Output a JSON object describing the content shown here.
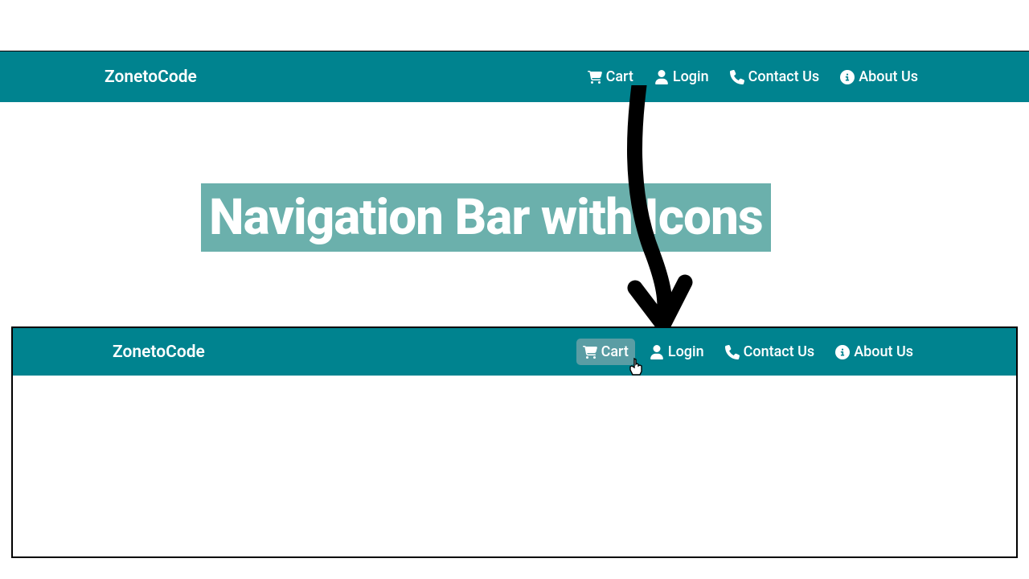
{
  "brand": "ZonetoCode",
  "banner_title": "Navigation Bar with Icons",
  "nav": {
    "cart": {
      "label": "Cart"
    },
    "login": {
      "label": "Login"
    },
    "contact": {
      "label": "Contact Us"
    },
    "about": {
      "label": "About Us"
    }
  }
}
